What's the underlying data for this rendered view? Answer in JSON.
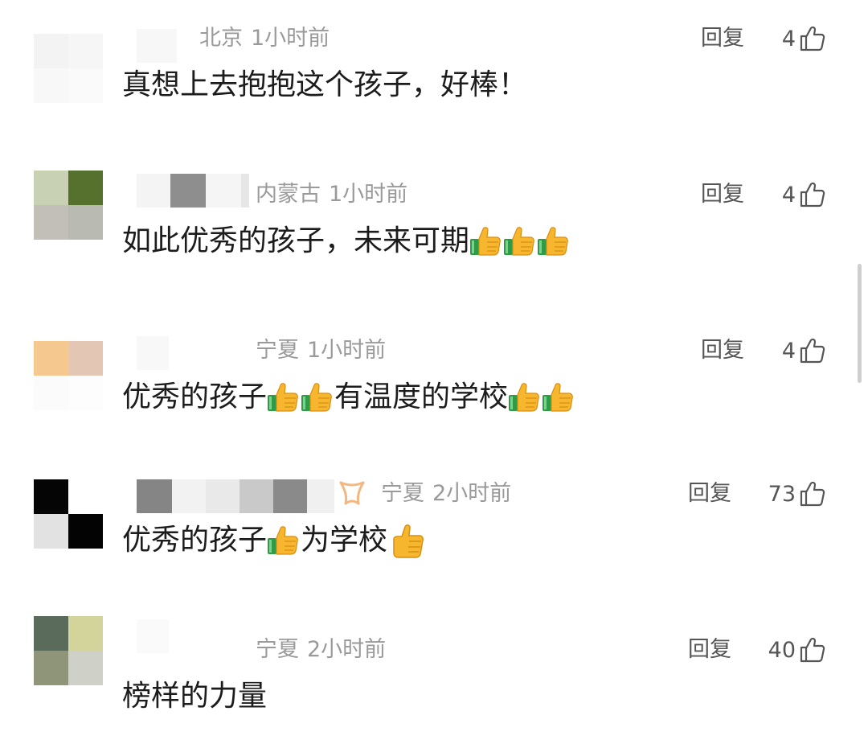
{
  "ui": {
    "reply_label": "回复",
    "colors": {
      "meta_text": "#9a9a9a",
      "action_text": "#555555",
      "content_text": "#1c1c1c",
      "thumb_yellow": "#f6b62d",
      "cuff_green": "#2e9b46"
    },
    "icons": {
      "like": "thumbs-up-outline-icon",
      "emoji": "thumbs-up-emoji-icon",
      "badge": "crown-badge-icon"
    }
  },
  "comments": [
    {
      "location": "北京",
      "time": "1小时前",
      "likes": "4",
      "segments": [
        {
          "type": "text",
          "value": "真想上去抱抱这个孩子，好棒！"
        }
      ]
    },
    {
      "location": "内蒙古",
      "time": "1小时前",
      "likes": "4",
      "segments": [
        {
          "type": "text",
          "value": "如此优秀的孩子，未来可期"
        },
        {
          "type": "emoji"
        },
        {
          "type": "emoji"
        },
        {
          "type": "emoji"
        }
      ]
    },
    {
      "location": "宁夏",
      "time": "1小时前",
      "likes": "4",
      "segments": [
        {
          "type": "text",
          "value": "优秀的孩子"
        },
        {
          "type": "emoji"
        },
        {
          "type": "emoji"
        },
        {
          "type": "text",
          "value": "有温度的学校"
        },
        {
          "type": "emoji"
        },
        {
          "type": "emoji"
        }
      ]
    },
    {
      "location": "宁夏",
      "time": "2小时前",
      "likes": "73",
      "segments": [
        {
          "type": "text",
          "value": "优秀的孩子"
        },
        {
          "type": "emoji"
        },
        {
          "type": "text",
          "value": "为学校"
        },
        {
          "type": "emoji_big"
        }
      ]
    },
    {
      "location": "宁夏",
      "time": "2小时前",
      "likes": "40",
      "segments": [
        {
          "type": "text",
          "value": "榜样的力量"
        }
      ]
    }
  ]
}
